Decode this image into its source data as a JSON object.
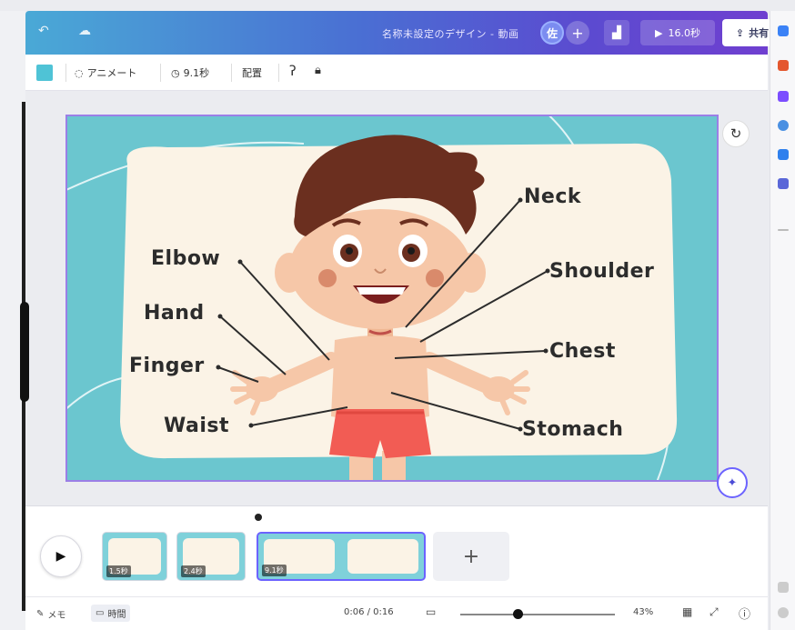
{
  "topbar": {
    "undo_icon": "undo-icon",
    "cloud_icon": "cloud-saved-icon",
    "document_title": "名称未設定のデザイン - 動画",
    "avatar_initial": "佐",
    "play_duration": "16.0秒",
    "share_label": "共有"
  },
  "toolbar": {
    "animate_label": "アニメート",
    "duration_label": "9.1秒",
    "position_label": "配置"
  },
  "slide": {
    "labels": {
      "neck": "Neck",
      "elbow": "Elbow",
      "shoulder": "Shoulder",
      "hand": "Hand",
      "finger": "Finger",
      "chest": "Chest",
      "waist": "Waist",
      "stomach": "Stomach"
    },
    "colors": {
      "background": "#6bc6cf",
      "card": "#fbf3e6",
      "selection": "#9b7fe6",
      "label_text": "#2c2c2c"
    }
  },
  "timeline": {
    "pages": [
      {
        "duration": "1.5秒"
      },
      {
        "duration": "2.4秒"
      },
      {
        "duration": "9.1秒"
      },
      {
        "duration": ""
      }
    ],
    "add_label": "+"
  },
  "bottombar": {
    "notes_label": "メモ",
    "timing_label": "時間",
    "time_readout": "0:06 / 0:16",
    "zoom_percent": "43%"
  }
}
